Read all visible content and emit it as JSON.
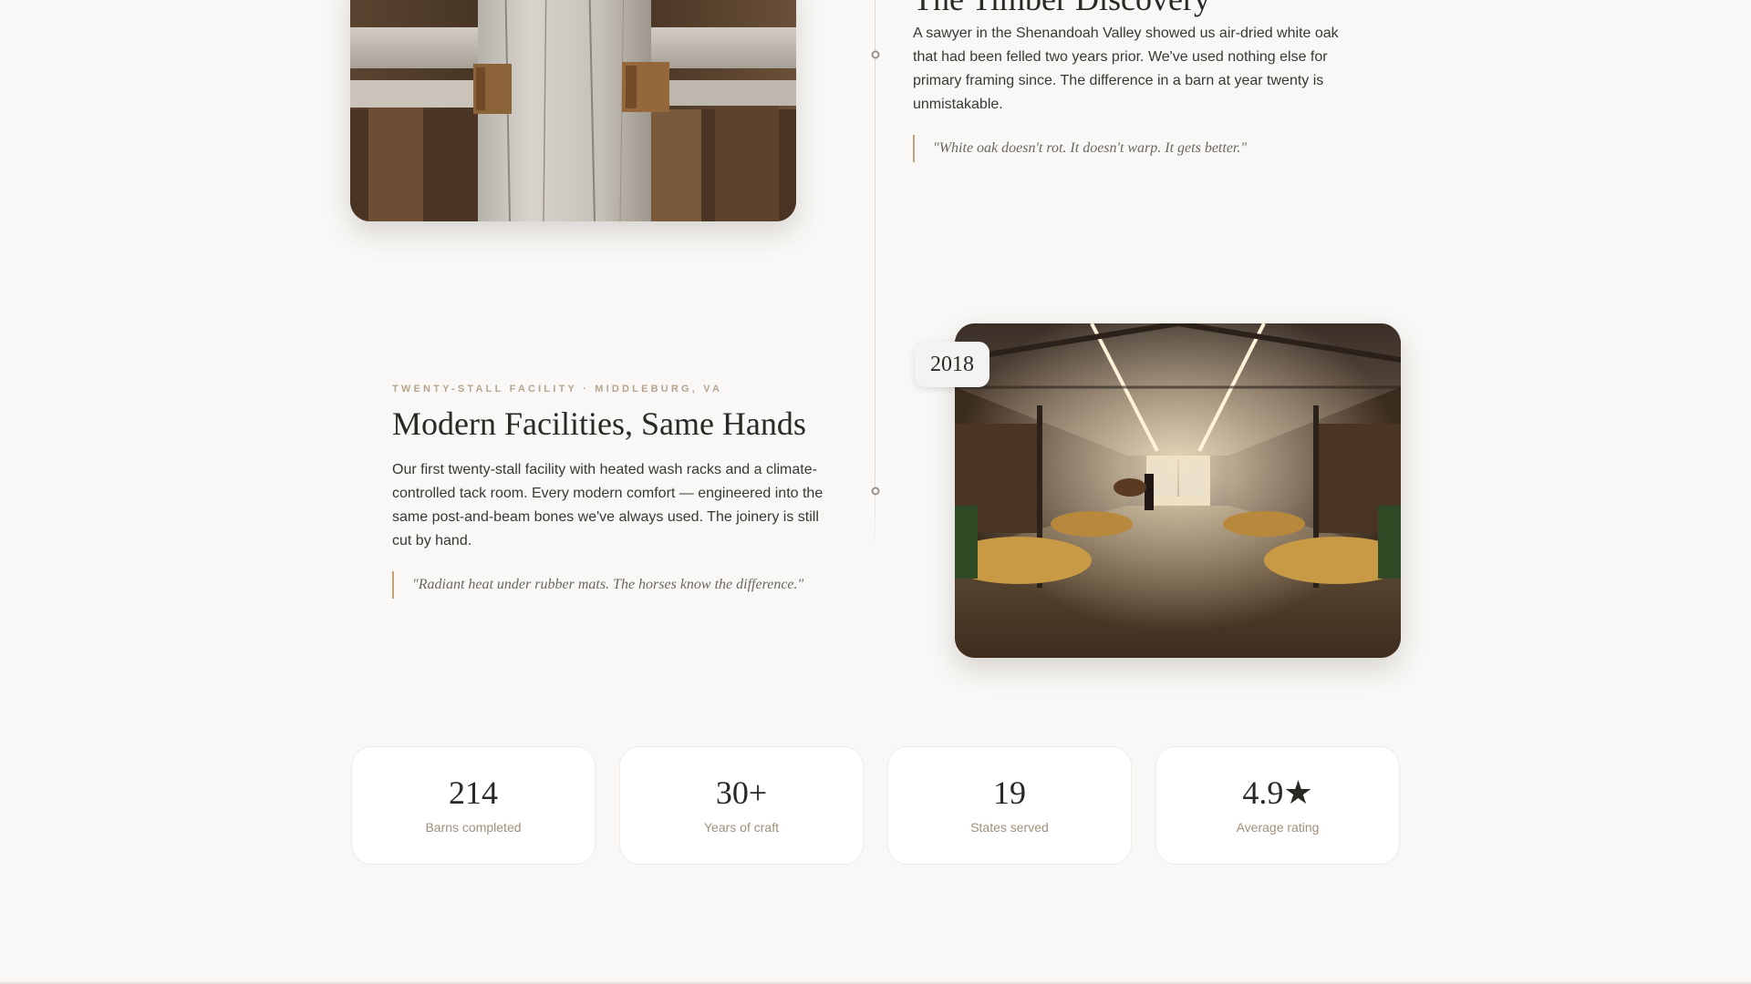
{
  "story_2017": {
    "title": "The Timber Discovery",
    "body": "A sawyer in the Shenandoah Valley showed us air-dried white oak that had been felled two years prior. We've used nothing else for primary framing since. The difference in a barn at year twenty is unmistakable.",
    "quote": "\"White oak doesn't rot. It doesn't warp. It gets better.\""
  },
  "story_2018": {
    "year": "2018",
    "eyebrow": "Twenty-stall facility · Middleburg, VA",
    "title": "Modern Facilities, Same Hands",
    "body": "Our first twenty-stall facility with heated wash racks and a climate-controlled tack room. Every modern comfort — engineered into the same post-and-beam bones we've always used. The joinery is still cut by hand.",
    "quote": "\"Radiant heat under rubber mats. The horses know the difference.\""
  },
  "stats": [
    {
      "value": "214",
      "label": "Barns completed"
    },
    {
      "value": "30+",
      "label": "Years of craft"
    },
    {
      "value": "19",
      "label": "States served"
    },
    {
      "value": "4.9★",
      "label": "Average rating"
    }
  ],
  "colors": {
    "background": "#f9f8f6",
    "accent": "#c6a27a",
    "eyebrow": "#b6a48d",
    "stat_label": "#a18f7b"
  }
}
